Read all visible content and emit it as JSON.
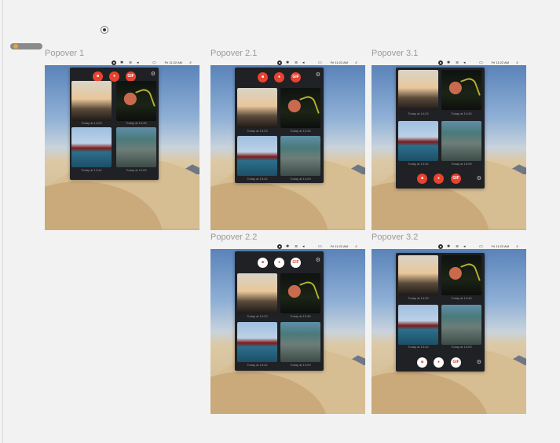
{
  "titles": {
    "p1": "Popover 1",
    "p21": "Popover 2.1",
    "p22": "Popover 2.2",
    "p31": "Popover 3.1",
    "p32": "Popover 3.2"
  },
  "menubar": {
    "clock": "Fri 11:22 AM",
    "search_glyph": "⌕",
    "wifi_glyph": "≋",
    "volume_glyph": "◂",
    "battery_glyph": "▭"
  },
  "toolbar": {
    "video_label": "■",
    "camera_label": "●",
    "gif_label": "GIF",
    "settings_icon": "⚙"
  },
  "captures": [
    "Today at 14:23",
    "Today at 13:45",
    "Today at 13:42",
    "Today at 13:09"
  ],
  "colors": {
    "accent": "#e8432f",
    "popover_bg": "#1f2125",
    "canvas_bg": "#f2f2f2"
  }
}
